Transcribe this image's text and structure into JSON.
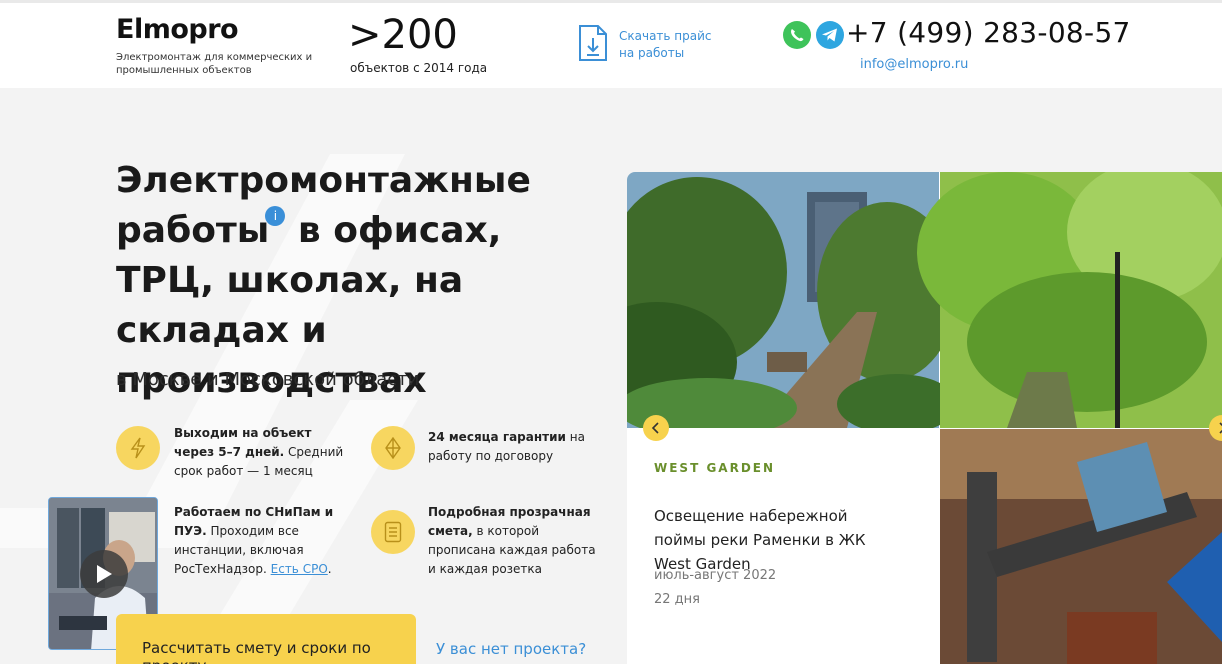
{
  "header": {
    "logo": "Elmopro",
    "logo_sub": "Электромонтаж для коммерческих и промышленных объектов",
    "stat_number": ">200",
    "stat_label": "объектов с 2014 года",
    "download_label": "Скачать прайс на работы",
    "phone": "+7 (499) 283-08-57",
    "email": "info@elmopro.ru"
  },
  "hero": {
    "title_part1": "Электромонтажные работы",
    "info_glyph": "i",
    "title_part2": " в офисах, ТРЦ, школах, на складах и производствах",
    "subtitle": "в Москве и Московской области"
  },
  "features": [
    {
      "bold": "Выходим на объект через 5–7 дней.",
      "text": " Средний срок работ — 1 месяц",
      "icon": "lightning-icon"
    },
    {
      "bold": "24 месяца гарантии",
      "text": " на работу по договору",
      "icon": "diamond-icon"
    },
    {
      "bold": "Работаем по СНиПам и ПУЭ.",
      "text": " Проходим все инстанции, включая РосТехНадзор. ",
      "link": "Есть СРО",
      "tail": ".",
      "icon": "shield-icon"
    },
    {
      "bold": "Подробная прозрачная смета,",
      "text": " в которой прописана каждая работа и каждая розетка",
      "icon": "document-list-icon"
    }
  ],
  "cta": {
    "button": "Рассчитать смету и сроки по проекту",
    "no_project": "У вас нет проекта?"
  },
  "project": {
    "brand": "WEST GARDEN",
    "title": "Освещение набережной поймы реки Раменки в ЖК West Garden",
    "date": "июль-август 2022",
    "duration": "22 дня"
  },
  "colors": {
    "accent": "#f7d24d",
    "link": "#3b8fd6",
    "brand_green": "#6a8f2c"
  }
}
